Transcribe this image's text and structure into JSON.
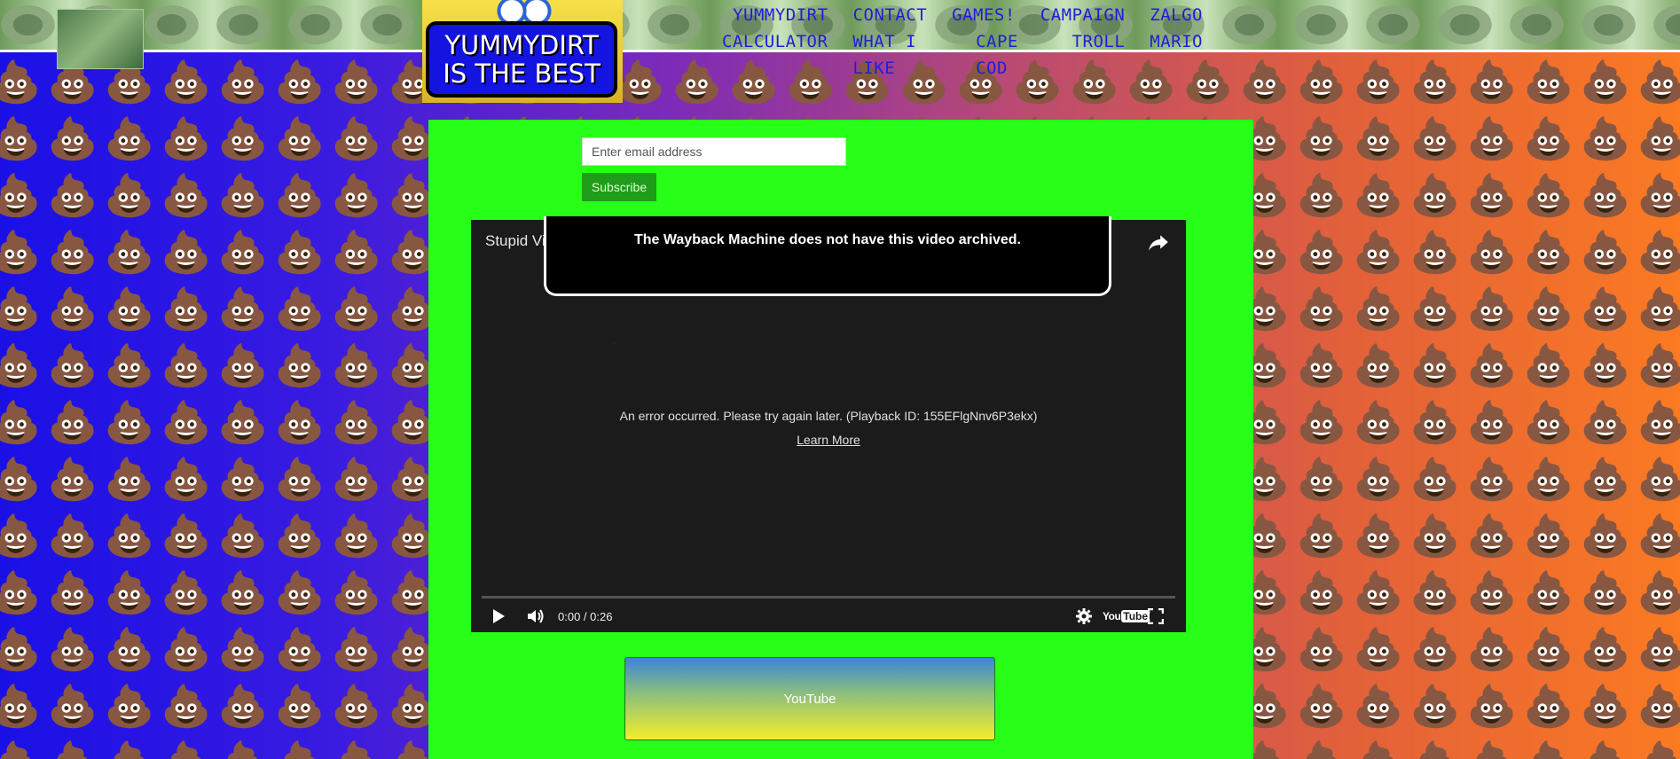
{
  "logo": {
    "line1": "YUMMYDIRT",
    "line2": "IS THE BEST"
  },
  "nav": {
    "row1": [
      "YUMMYDIRT",
      "CONTACT",
      "GAMES!",
      "CAMPAIGN",
      "ZALGO"
    ],
    "row2": [
      "CALCULATOR",
      "WHAT I LIKE",
      "CAPE COD",
      "TROLL",
      "MARIO"
    ]
  },
  "subscribe": {
    "email_placeholder": "Enter email address",
    "button_label": "Subscribe"
  },
  "video": {
    "title": "Stupid Video",
    "wayback_message": "The Wayback Machine does not have this video archived.",
    "error_message": "An error occurred. Please try again later. (Playback ID: 155EFlgNnv6P3ekx)",
    "learn_more": "Learn More",
    "time": "0:00 / 0:26",
    "youtube_logo": "YouTube"
  },
  "youtube_button": {
    "label": "YouTube"
  },
  "colors": {
    "panel": "#27ff18",
    "nav_link": "#1f1fd6",
    "logo_box": "#1414e0",
    "subscribe_bg": "#1f9c1a"
  },
  "icons": [
    "poop-emoji",
    "lizard-tile",
    "share-icon",
    "play-icon",
    "volume-icon",
    "settings-icon",
    "youtube-logo-icon",
    "fullscreen-icon"
  ]
}
